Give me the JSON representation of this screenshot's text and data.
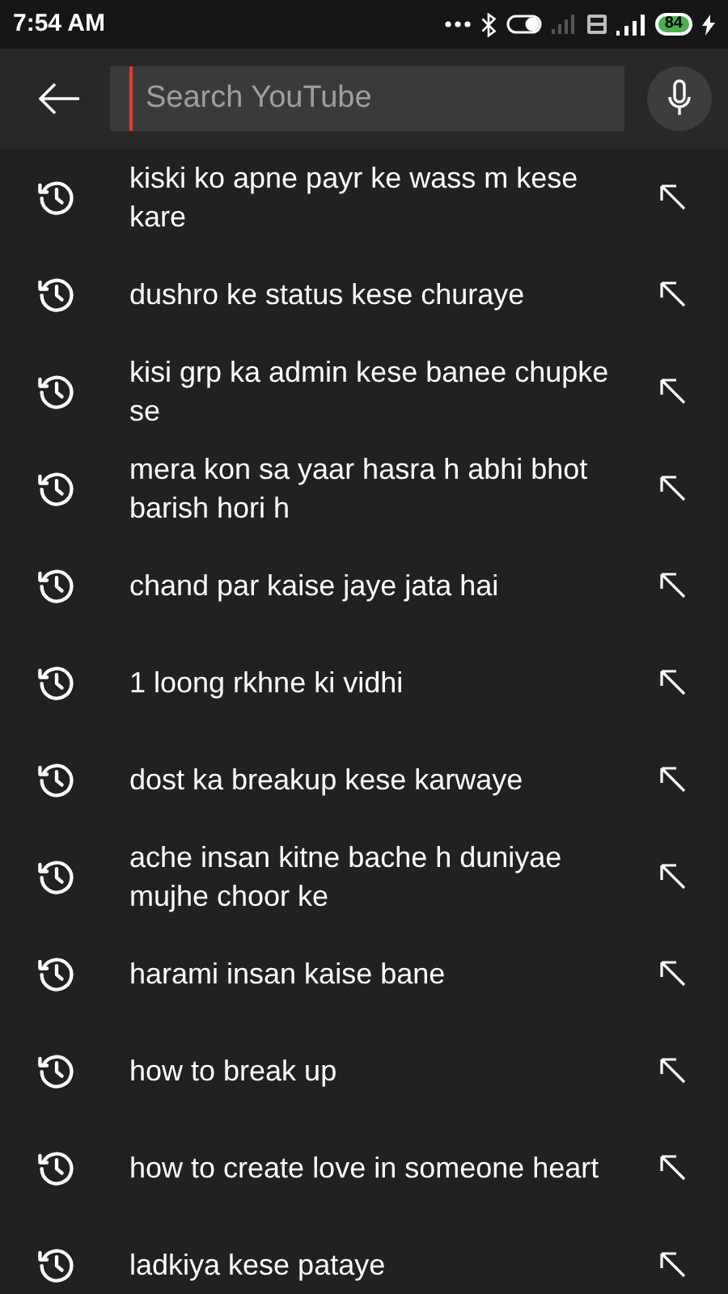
{
  "status_bar": {
    "time": "7:54 AM",
    "battery": "84"
  },
  "search": {
    "placeholder": "Search YouTube"
  },
  "suggestions": [
    {
      "text": "kiski ko apne payr ke wass m kese kare"
    },
    {
      "text": "dushro ke status kese churaye"
    },
    {
      "text": "kisi grp ka admin kese banee chupke se"
    },
    {
      "text": "mera kon sa yaar hasra h abhi bhot barish hori h"
    },
    {
      "text": "chand par kaise jaye jata hai"
    },
    {
      "text": "1 loong rkhne ki vidhi"
    },
    {
      "text": "dost ka breakup kese karwaye"
    },
    {
      "text": "ache insan kitne bache h duniyae mujhe choor ke"
    },
    {
      "text": "harami insan kaise bane"
    },
    {
      "text": "how to break up"
    },
    {
      "text": "how to create love in someone heart"
    },
    {
      "text": "ladkiya kese pataye"
    }
  ]
}
